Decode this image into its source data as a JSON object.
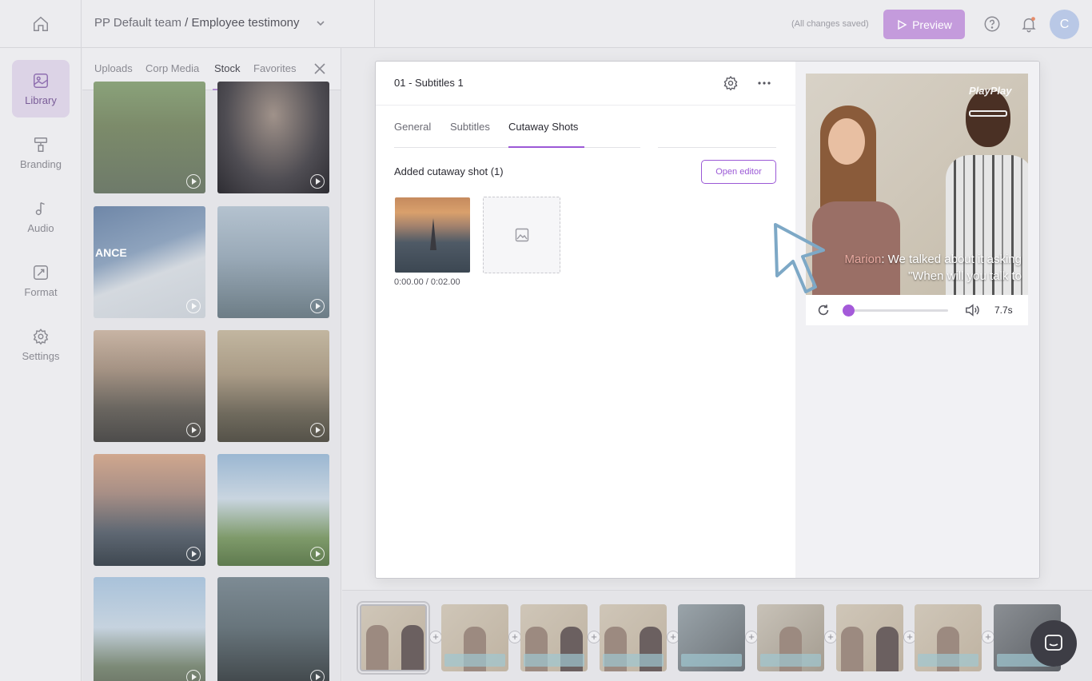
{
  "header": {
    "team": "PP Default team",
    "separator": "/",
    "project": "Employee testimony",
    "saved_status": "(All changes saved)",
    "preview_label": "Preview",
    "avatar_initial": "C"
  },
  "leftnav": {
    "items": [
      {
        "label": "Library",
        "icon": "library-icon",
        "active": true
      },
      {
        "label": "Branding",
        "icon": "paint-roller-icon"
      },
      {
        "label": "Audio",
        "icon": "music-note-icon"
      },
      {
        "label": "Format",
        "icon": "format-icon"
      },
      {
        "label": "Settings",
        "icon": "gear-icon"
      }
    ]
  },
  "library": {
    "tabs": [
      "Uploads",
      "Corp Media",
      "Stock",
      "Favorites"
    ],
    "active_tab": "Stock",
    "map_text": "ANCE"
  },
  "dialog": {
    "title": "01 - Subtitles 1",
    "tabs": [
      "General",
      "Subtitles",
      "Cutaway Shots"
    ],
    "active_tab": "Cutaway Shots",
    "added_label": "Added cutaway shot (1)",
    "open_editor_label": "Open editor",
    "shot_time": "0:00.00 / 0:02.00"
  },
  "preview": {
    "watermark": "PlayPlay",
    "subtitle_speaker": "Marion",
    "subtitle_text": ": We talked about it asking \"When will you talk to",
    "progress": 0.0,
    "duration": "7.7s"
  },
  "colors": {
    "accent": "#9b59d6",
    "preview_button": "#c49bdc"
  }
}
